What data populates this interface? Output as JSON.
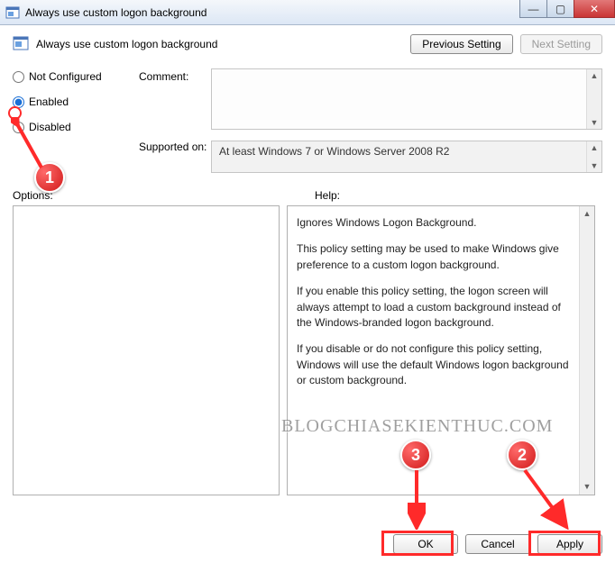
{
  "window": {
    "title": "Always use custom logon background"
  },
  "header": {
    "policy_title": "Always use custom logon background",
    "prev_button": "Previous Setting",
    "next_button": "Next Setting"
  },
  "radios": {
    "not_configured": "Not Configured",
    "enabled": "Enabled",
    "disabled": "Disabled"
  },
  "labels": {
    "comment": "Comment:",
    "supported": "Supported on:",
    "options": "Options:",
    "help": "Help:"
  },
  "supported_text": "At least Windows 7 or Windows Server 2008 R2",
  "help": {
    "p1": "Ignores Windows Logon Background.",
    "p2": "This policy setting may be used to make Windows give preference to a custom logon background.",
    "p3": "If you enable this policy setting, the logon screen will always attempt to load a custom background instead of the Windows-branded logon background.",
    "p4": "If you disable or do not configure this policy setting, Windows will use the default Windows logon background or custom background."
  },
  "footer": {
    "ok": "OK",
    "cancel": "Cancel",
    "apply": "Apply"
  },
  "watermark": "BLOGCHIASEKIENTHUC.COM",
  "annotations": {
    "badge1": "1",
    "badge2": "2",
    "badge3": "3"
  }
}
